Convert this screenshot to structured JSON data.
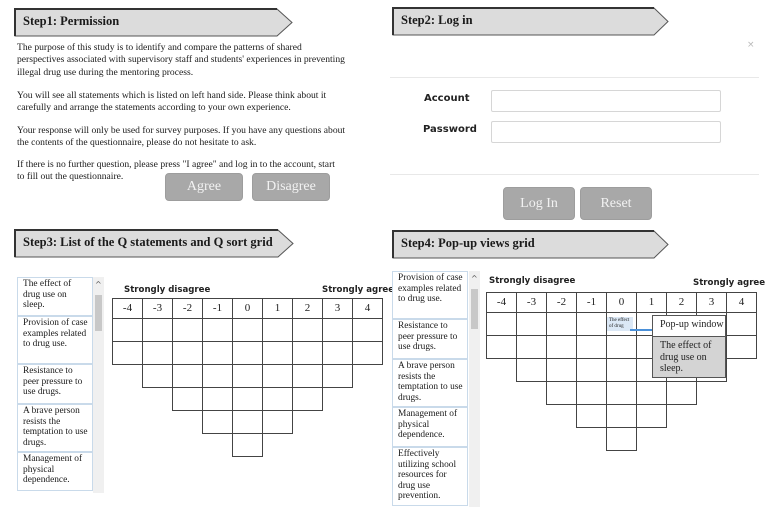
{
  "step1": {
    "title": "Step1: Permission",
    "paragraphs": [
      "The purpose of this study is to identify and compare the patterns of shared perspectives associated with supervisory staff and students' experiences in preventing illegal drug use during the mentoring process.",
      "You will see all statements which is listed on left hand side. Please think about it carefully and arrange the statements according to your own experience.",
      "Your response will only be used for survey purposes. If you have any questions about the contents of the questionnaire, please do not hesitate to ask.",
      "If there is no further question, please press \"I agree\" and log in to the account, start to fill out the questionnaire."
    ],
    "agree_label": "Agree",
    "disagree_label": "Disagree"
  },
  "step2": {
    "title": "Step2: Log in",
    "close_icon": "×",
    "account_label": "Account",
    "account_value": "",
    "password_label": "Password",
    "password_value": "",
    "login_label": "Log In",
    "reset_label": "Reset"
  },
  "step3": {
    "title": "Step3: List of the Q statements and Q sort grid",
    "statements": [
      "The effect of drug use on sleep.",
      "Provision of case examples related to drug use.",
      "Resistance to peer pressure to use drugs.",
      "A brave person resists the temptation to use drugs.",
      "Management of physical dependence."
    ],
    "scroll_up_icon": "^",
    "grid": {
      "left_label": "Strongly disagree",
      "right_label": "Strongly agree",
      "columns": [
        "-4",
        "-3",
        "-2",
        "-1",
        "0",
        "1",
        "2",
        "3",
        "4"
      ],
      "column_slots": [
        2,
        3,
        4,
        5,
        6,
        5,
        4,
        3,
        2
      ]
    }
  },
  "step4": {
    "title": "Step4: Pop-up views grid",
    "statements": [
      "Provision of case examples related to drug use.",
      "Resistance to peer pressure to use drugs.",
      "A brave person resists the temptation to use drugs.",
      "Management of physical dependence.",
      "Effectively utilizing school resources for drug use prevention."
    ],
    "scroll_up_icon": "^",
    "grid": {
      "left_label": "Strongly disagree",
      "right_label": "Strongly agree",
      "columns": [
        "-4",
        "-3",
        "-2",
        "-1",
        "0",
        "1",
        "2",
        "3",
        "4"
      ],
      "column_slots": [
        2,
        3,
        4,
        5,
        6,
        5,
        4,
        3,
        2
      ]
    },
    "placed_chip": "The effect of drug",
    "popup": {
      "title": "Pop-up window",
      "body": "The effect of drug use on sleep."
    }
  }
}
